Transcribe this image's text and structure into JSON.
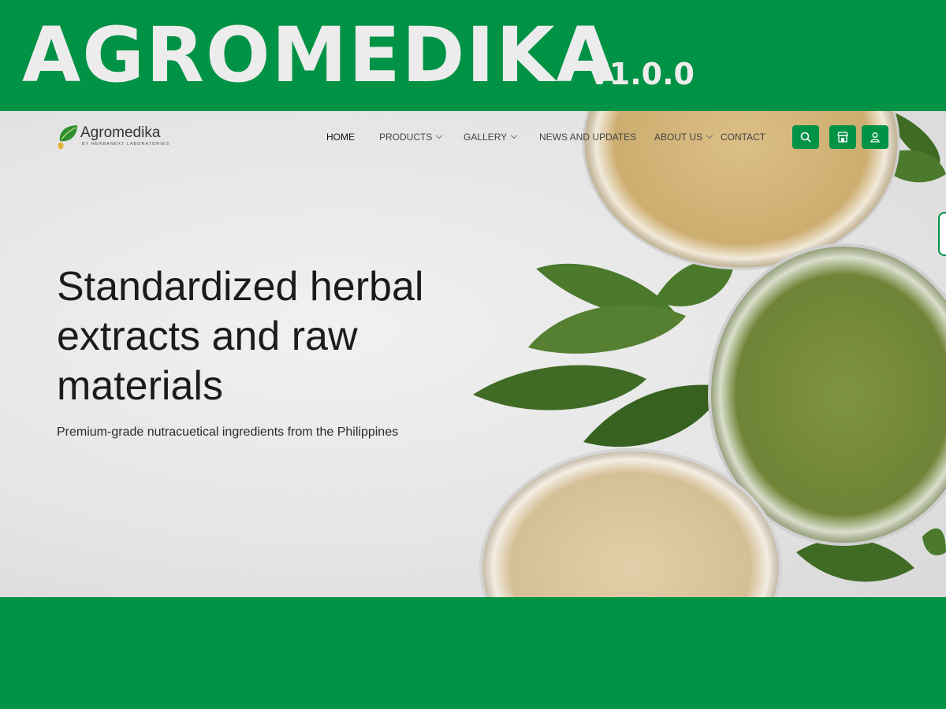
{
  "banner": {
    "title": "AGROMEDIKA",
    "version": "v1.0.0"
  },
  "site": {
    "logo": {
      "name": "Agromedika",
      "tagline": "BY HERBANEXT LABORATORIES"
    },
    "nav": [
      {
        "label": "HOME",
        "active": true,
        "dropdown": false
      },
      {
        "label": "PRODUCTS",
        "active": false,
        "dropdown": true
      },
      {
        "label": "GALLERY",
        "active": false,
        "dropdown": true
      },
      {
        "label": "NEWS AND UPDATES",
        "active": false,
        "dropdown": false
      },
      {
        "label": "ABOUT US",
        "active": false,
        "dropdown": true
      },
      {
        "label": "CONTACT",
        "active": false,
        "dropdown": false
      }
    ],
    "actions": [
      {
        "icon": "search-icon"
      },
      {
        "icon": "store-icon"
      },
      {
        "icon": "user-icon"
      }
    ],
    "hero": {
      "title": "Standardized herbal extracts and raw materials",
      "subtitle": "Premium-grade nutracuetical ingredients from the Philippines"
    }
  },
  "colors": {
    "brand_green": "#009245",
    "banner_text": "#ececec",
    "leaf_green": "#3f6b25"
  }
}
